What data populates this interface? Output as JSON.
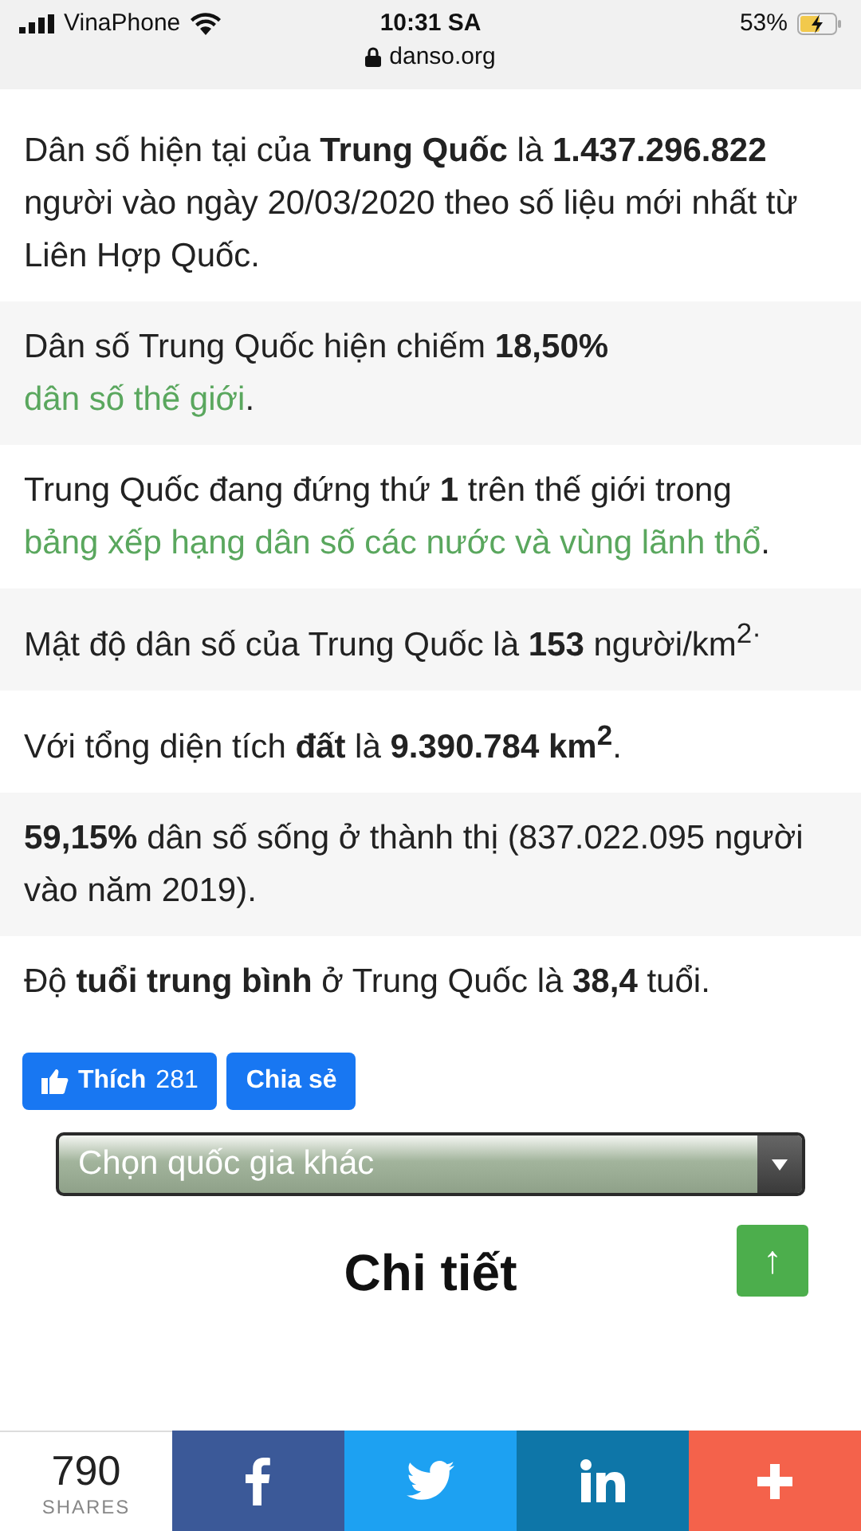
{
  "status_bar": {
    "carrier": "VinaPhone",
    "time": "10:31 SA",
    "battery": "53%",
    "url": "danso.org"
  },
  "facts": [
    {
      "segments": [
        {
          "kind": "text",
          "text": "Dân số hiện tại của **Trung Quốc** là **1.437.296.822** người vào ngày 20/03/2020 theo số liệu mới nhất từ Liên Hợp Quốc."
        }
      ]
    },
    {
      "segments": [
        {
          "kind": "text",
          "text": "Dân số Trung Quốc hiện chiếm **18,50%** "
        },
        {
          "kind": "link",
          "text": "dân số thế giới"
        },
        {
          "kind": "text",
          "text": "."
        }
      ]
    },
    {
      "segments": [
        {
          "kind": "text",
          "text": "Trung Quốc đang đứng thứ **1** trên thế giới trong "
        },
        {
          "kind": "link",
          "text": "bảng xếp hạng dân số các nước và vùng lãnh thổ"
        },
        {
          "kind": "text",
          "text": "."
        }
      ]
    },
    {
      "segments": [
        {
          "kind": "text",
          "text": "Mật độ dân số của Trung Quốc là **153** người/km$^{2·}$"
        }
      ]
    },
    {
      "segments": [
        {
          "kind": "text",
          "text": "Với tổng diện tích **đất** là **9.390.784 km$^{2}$**."
        }
      ]
    },
    {
      "segments": [
        {
          "kind": "text",
          "text": "**59,15%** dân số sống ở thành thị (837.022.095 người vào năm 2019)."
        }
      ]
    },
    {
      "segments": [
        {
          "kind": "text",
          "text": "Độ **tuổi trung bình** ở Trung Quốc là **38,4** tuổi."
        }
      ]
    }
  ],
  "like_button": {
    "label": "Thích",
    "count": "281"
  },
  "share_button": {
    "label": "Chia sẻ"
  },
  "country_select": {
    "placeholder": "Chọn quốc gia khác"
  },
  "scroll_top": {
    "label": "↑"
  },
  "heading": "Chi tiết",
  "share_bar": {
    "count": "790",
    "count_label": "SHARES",
    "buttons": [
      {
        "kind": "facebook"
      },
      {
        "kind": "twitter"
      },
      {
        "kind": "linkedin"
      },
      {
        "kind": "more"
      }
    ]
  }
}
